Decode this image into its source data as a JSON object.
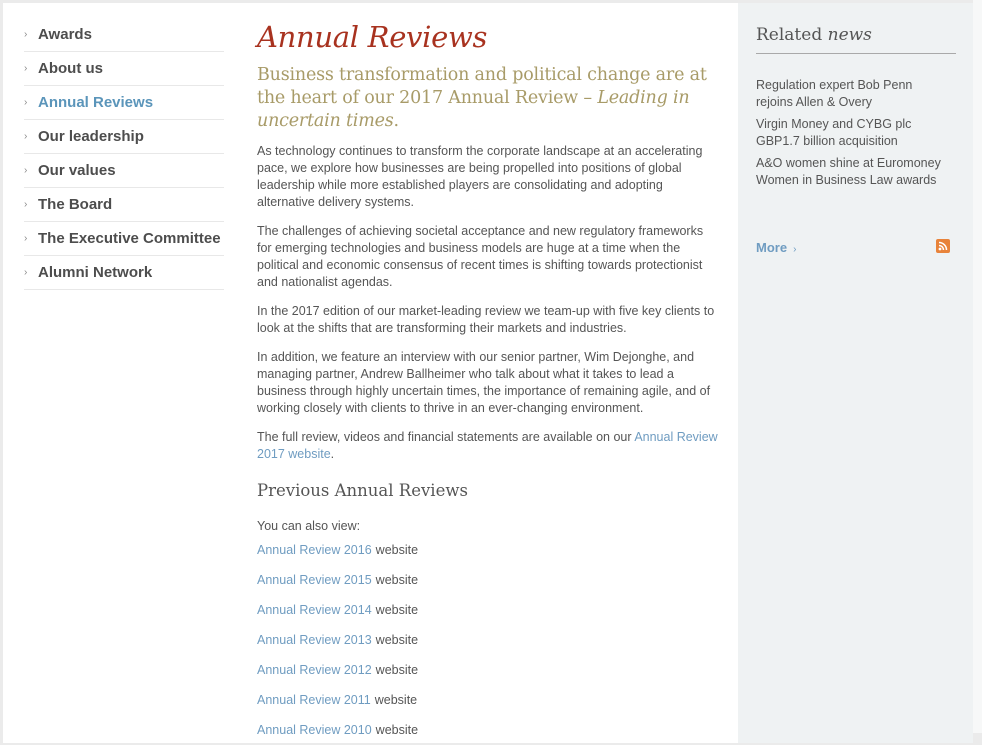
{
  "sidebar": {
    "items": [
      {
        "label": "Awards"
      },
      {
        "label": "About us"
      },
      {
        "label": "Annual Reviews",
        "active": true
      },
      {
        "label": "Our leadership"
      },
      {
        "label": "Our values"
      },
      {
        "label": "The Board"
      },
      {
        "label": "The Executive Committee"
      },
      {
        "label": "Alumni Network"
      }
    ],
    "chevron": "›"
  },
  "main": {
    "title": "Annual Reviews",
    "intro_plain": "Business transformation and political change are at the heart of our 2017 Annual Review – ",
    "intro_italic": "Leading in uncertain times",
    "intro_end": ".",
    "paragraphs": [
      "As technology continues to transform the corporate landscape at an accelerating pace, we explore how businesses are being propelled into positions of global leadership while more established players are consolidating and adopting alternative delivery systems.",
      "The challenges of achieving societal acceptance and new regulatory frameworks for emerging technologies and business models are huge at a time when the political and economic consensus of recent times is shifting towards protectionist and nationalist agendas.",
      "In the 2017 edition of our market-leading review we team-up with five key clients to look at the shifts that are transforming their markets and industries.",
      "In addition, we feature an interview with our senior partner, Wim Dejonghe, and managing partner, Andrew Ballheimer who talk about what it takes to lead a business through highly uncertain times, the importance of remaining agile, and of working closely with clients to thrive in an ever-changing environment."
    ],
    "full_review_text": "The full review, videos and financial statements are available on our ",
    "full_review_link": "Annual Review 2017 website",
    "full_review_end": ".",
    "previous_heading": "Previous Annual Reviews",
    "view_text": "You can also view:",
    "previous": [
      {
        "link": "Annual Review 2016",
        "suffix": "website"
      },
      {
        "link": "Annual Review 2015",
        "suffix": "website"
      },
      {
        "link": "Annual Review 2014",
        "suffix": "website"
      },
      {
        "link": "Annual Review 2013",
        "suffix": "website"
      },
      {
        "link": "Annual Review 2012",
        "suffix": "website"
      },
      {
        "link": "Annual Review 2011",
        "suffix": "website"
      },
      {
        "link": "Annual Review 2010",
        "suffix": "website"
      }
    ]
  },
  "aside": {
    "heading_plain": "Related ",
    "heading_italic": "news",
    "news": [
      "Regulation expert Bob Penn rejoins Allen & Overy",
      "Virgin Money and CYBG plc GBP1.7 billion acquisition",
      "A&O women shine at Euromoney Women in Business Law awards"
    ],
    "more_label": "More",
    "more_chevron": "›",
    "rss_icon": "rss-icon"
  },
  "colors": {
    "title": "#a8321f",
    "intro": "#a89b68",
    "link": "#6f9cc1",
    "text": "#555555",
    "aside_bg": "#eff2f3",
    "rss": "#e8833a"
  }
}
